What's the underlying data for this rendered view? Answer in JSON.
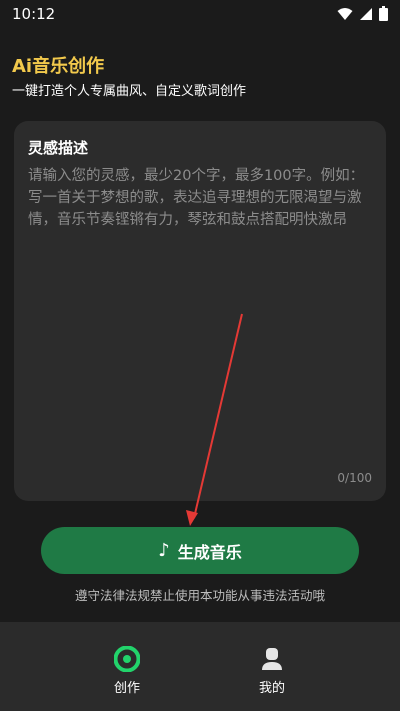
{
  "status_bar": {
    "time": "10:12"
  },
  "header": {
    "title": "Ai音乐创作",
    "subtitle": "一键打造个人专属曲风、自定义歌词创作"
  },
  "inspiration": {
    "title": "灵感描述",
    "placeholder": "请输入您的灵感，最少20个字，最多100字。例如：写一首关于梦想的歌，表达追寻理想的无限渴望与激情，音乐节奏铿锵有力，琴弦和鼓点搭配明快激昂",
    "char_count": "0/100"
  },
  "generate_button": {
    "icon": "music-note-icon",
    "label": "生成音乐"
  },
  "notice": "遵守法律法规禁止使用本功能从事违法活动哦",
  "bottom_nav": {
    "items": [
      {
        "label": "创作",
        "icon": "create-icon",
        "active": true
      },
      {
        "label": "我的",
        "icon": "profile-icon",
        "active": false
      }
    ]
  },
  "colors": {
    "title_accent": "#f2c94c",
    "primary_button": "#1f7a45",
    "active_nav": "#22d36b",
    "arrow": "#e53935"
  }
}
